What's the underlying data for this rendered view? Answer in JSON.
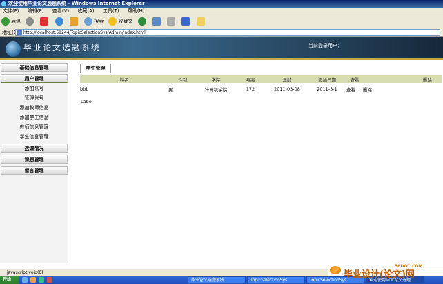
{
  "window": {
    "title": "欢迎使用毕业论文选题系统 - Windows Internet Explorer"
  },
  "menu": [
    "文件(F)",
    "编辑(E)",
    "查看(V)",
    "收藏(A)",
    "工具(T)",
    "帮助(H)"
  ],
  "toolbar": {
    "back": "后退",
    "search": "搜索",
    "favorites": "收藏夹"
  },
  "address": {
    "label": "地址(D)",
    "url": "http://localhost:58244/TopicSelectionSys/Admin/index.html"
  },
  "banner": {
    "logo": "毕业论文选题系统",
    "user_label": "当前登录用户："
  },
  "sidebar": {
    "basic": "基础信息管理",
    "user_mgmt": "用户管理",
    "items": [
      "添加账号",
      "管理账号",
      "添加教师信息",
      "添加学生信息",
      "教师信息管理",
      "学生信息管理"
    ],
    "selection": "选课情况",
    "topic": "课题管理",
    "message": "留言管理"
  },
  "tab": {
    "label": "学生管理"
  },
  "table": {
    "headers": [
      "姓名",
      "性别",
      "学院",
      "身高",
      "年龄",
      "添加日期",
      "查看",
      "删除"
    ],
    "rows": [
      {
        "name": "bbb",
        "gender": "男",
        "college": "计算机学院",
        "height": "172",
        "age": "2011-03-08",
        "date": "2011-3-1",
        "view": "查看",
        "delete": "删除"
      }
    ]
  },
  "label": "Label",
  "status": {
    "text": "javascript:void(0)"
  },
  "taskbar": {
    "start": "开始",
    "tasks": [
      "毕业论文选题系统",
      "TopicSelectionSys",
      "TopicSelectionSys",
      "欢迎使用毕业论文选题"
    ]
  },
  "watermark": {
    "site": "56DOC.COM",
    "text": "毕业设计(论文)网"
  }
}
